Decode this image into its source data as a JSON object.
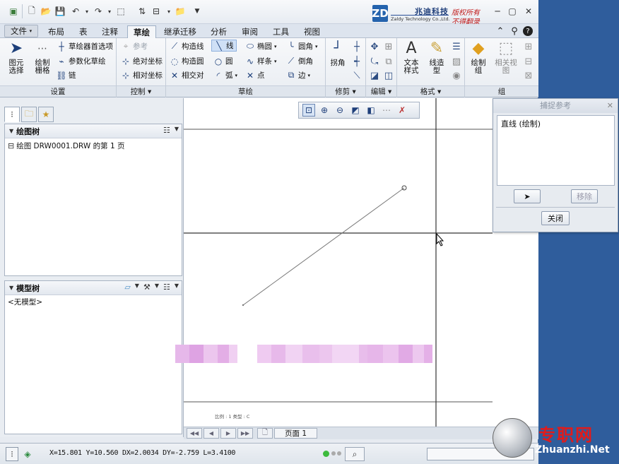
{
  "brand": {
    "logo_letter": "ZD",
    "name_cn": "兆迪科技",
    "name_en": "Zaldy Technology Co.,Ltd.",
    "slogan_1": "版权所有",
    "slogan_2": "不得翻录"
  },
  "tabs": [
    {
      "label": "文件"
    },
    {
      "label": "布局"
    },
    {
      "label": "表"
    },
    {
      "label": "注释"
    },
    {
      "label": "草绘"
    },
    {
      "label": "继承迁移"
    },
    {
      "label": "分析"
    },
    {
      "label": "审阅"
    },
    {
      "label": "工具"
    },
    {
      "label": "视图"
    }
  ],
  "ribbon": {
    "groups": {
      "settings": "设置",
      "control": "控制",
      "sketch": "草绘",
      "trim": "修剪",
      "edit": "编辑",
      "format": "格式",
      "group": "组"
    },
    "settings": {
      "select_1": "图元",
      "select_2": "选择",
      "grid_1": "绘制",
      "grid_2": "栅格",
      "prefs": "草绘器首选项",
      "param": "参数化草绘",
      "chain": "链"
    },
    "control": {
      "ref": "参考",
      "abs": "绝对坐标",
      "rel": "相对坐标"
    },
    "sketch": {
      "cline": "构造线",
      "ccircle": "构造圆",
      "relcoord": "相交对",
      "line": "线",
      "circle": "圆",
      "arc": "弧",
      "ellipse": "椭圆",
      "spline": "样条",
      "point": "点",
      "fillet": "圆角",
      "chamfer": "倒角",
      "edge": "边"
    },
    "trim": {
      "corner": "拐角"
    },
    "format": {
      "text_1": "文本",
      "text_2": "样式",
      "line_1": "线造",
      "line_2": "型"
    },
    "group": {
      "draw_1": "绘制",
      "draw_2": "组",
      "related_1": "相关视",
      "related_2": "图"
    }
  },
  "panel": {
    "draw_tree_title": "绘图树",
    "draw_tree_item": "绘图 DRW0001.DRW 的第 1 页",
    "model_tree_title": "模型树",
    "model_tree_item": "<无模型>"
  },
  "canvas": {
    "small_note": "比例 : 1   类型 : C"
  },
  "snap_dialog": {
    "title": "捕捉参考",
    "list_item": "直线 (绘制)",
    "remove": "移除",
    "close": "关闭"
  },
  "page_nav": {
    "page_label": "页面 1"
  },
  "status": {
    "coords": "X=15.801 Y=10.560 DX=2.0034 DY=-2.759 L=3.4100"
  },
  "watermark": {
    "cn": "专职网",
    "url": "Zhuanzhi.Net"
  }
}
